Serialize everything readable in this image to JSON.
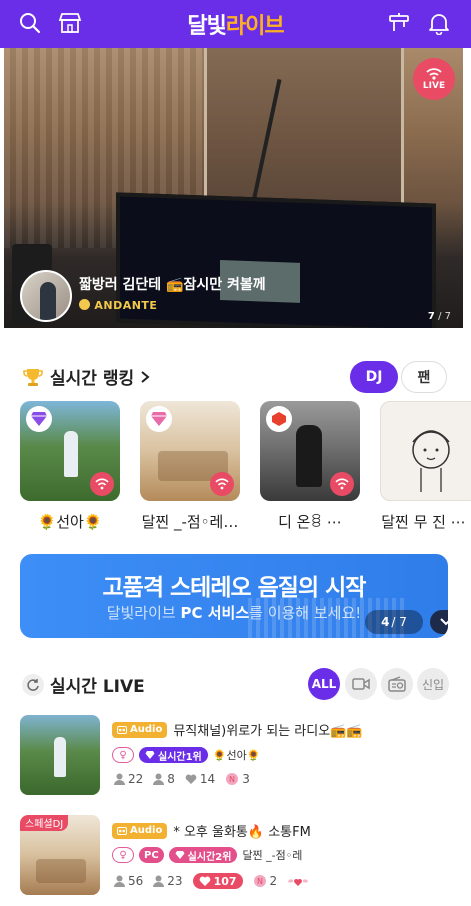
{
  "header": {
    "logo_part1": "달빛",
    "logo_part2": "라이브",
    "icons": [
      "search-icon",
      "store-icon",
      "broadcast-icon",
      "bell-icon"
    ]
  },
  "hero": {
    "live_label": "LIVE",
    "title": "짧방러 김단테 📻잠시만 켜볼께",
    "subtitle": "ANDANTE",
    "page_current": "7",
    "page_total": "/ 7"
  },
  "ranking": {
    "title": "실시간 랭킹",
    "tab_dj": "DJ",
    "tab_fan": "팬",
    "items": [
      {
        "name": "🌻선아🌻",
        "gem": "purple"
      },
      {
        "name": "달찐 _-점◦레…",
        "gem": "pink"
      },
      {
        "name": "디 온ꊞ ⋯",
        "gem": "red"
      },
      {
        "name": "달찐 무 진 ⋯",
        "gem": "none"
      }
    ]
  },
  "banner": {
    "headline": "고품격 스테레오 음질의 시작",
    "sub_prefix": "달빛라이브",
    "sub_bold": "PC 서비스",
    "sub_suffix": "를 이용해 보세요!",
    "page_current": "4",
    "page_total": "/ 7"
  },
  "live": {
    "title": "실시간 LIVE",
    "filters": [
      "ALL",
      "video",
      "radio",
      "신입"
    ],
    "streams": [
      {
        "tag": "Audio",
        "title": "뮤직채널)위로가 되는 라디오📻📻",
        "rank_label": "실시간1위",
        "dj": "🌻선아🌻",
        "listeners": "22",
        "fans": "8",
        "likes": "14",
        "boosts": "3"
      },
      {
        "corner": "스페셜DJ",
        "tag": "Audio",
        "title": "* 오후 울화통🔥 소통FM",
        "pc": "PC",
        "rank_label": "실시간2위",
        "dj": "달찐 _-점◦레",
        "listeners": "56",
        "fans": "23",
        "likes": "107",
        "boosts": "2"
      }
    ]
  },
  "colors": {
    "brand": "#6a2ee8",
    "logo_accent": "#ffb020",
    "live_red": "#e94a64",
    "audio_tag": "#f3b132",
    "banner_blue": "#3e8ef7"
  }
}
